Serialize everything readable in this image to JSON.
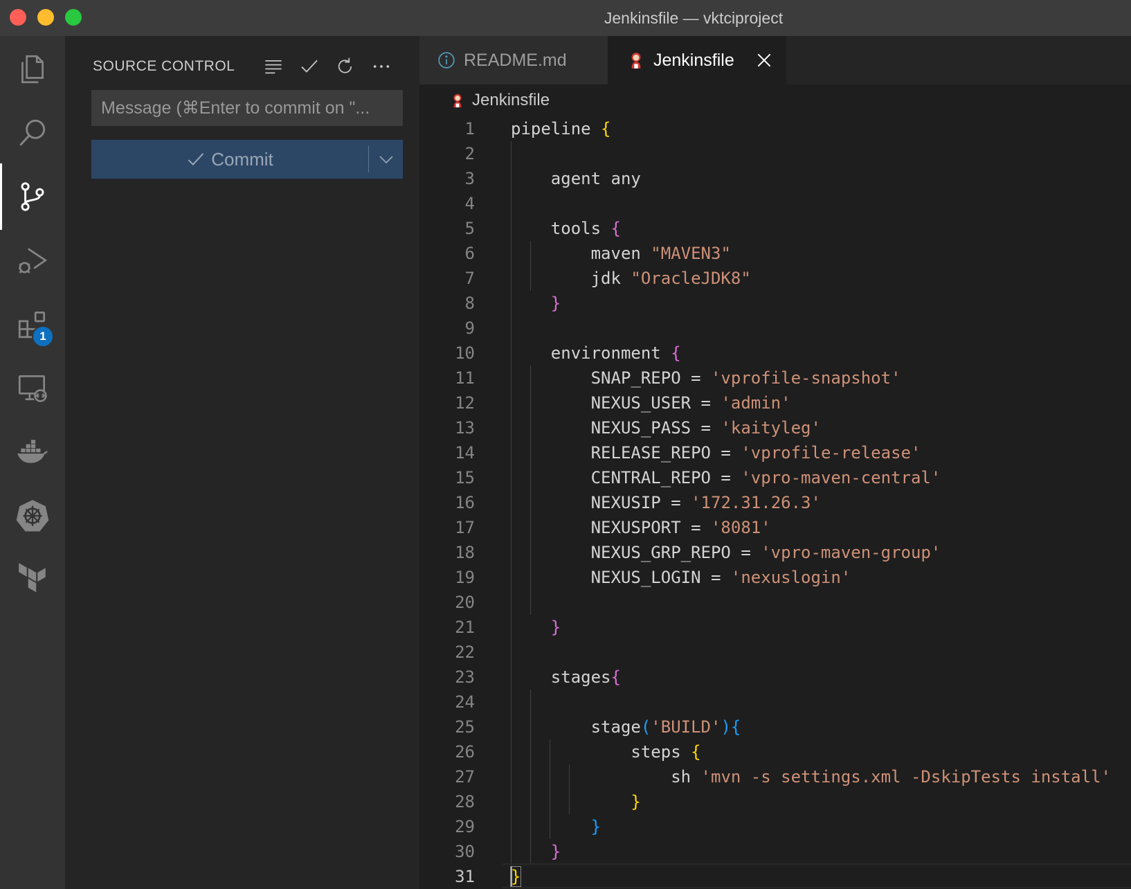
{
  "window": {
    "title": "Jenkinsfile — vktciproject"
  },
  "activity_bar": {
    "items": [
      {
        "name": "explorer-icon"
      },
      {
        "name": "search-icon"
      },
      {
        "name": "source-control-icon",
        "active": true
      },
      {
        "name": "run-debug-icon"
      },
      {
        "name": "extensions-icon",
        "badge": "1"
      },
      {
        "name": "remote-explorer-icon"
      },
      {
        "name": "docker-icon"
      },
      {
        "name": "kubernetes-icon"
      },
      {
        "name": "terraform-icon"
      }
    ]
  },
  "sidebar": {
    "title": "SOURCE CONTROL",
    "message_placeholder": "Message (⌘Enter to commit on \"...",
    "commit_label": "Commit"
  },
  "tabs": [
    {
      "label": "README.md",
      "active": false
    },
    {
      "label": "Jenkinsfile",
      "active": true
    }
  ],
  "breadcrumb": "Jenkinsfile",
  "editor": {
    "current_line": 31,
    "lines": [
      [
        [
          "t",
          "pipeline "
        ],
        [
          "b1",
          "{"
        ]
      ],
      [],
      [
        [
          "t",
          "    agent any"
        ]
      ],
      [],
      [
        [
          "t",
          "    tools "
        ],
        [
          "b2",
          "{"
        ]
      ],
      [
        [
          "t",
          "        maven "
        ],
        [
          "s",
          "\"MAVEN3\""
        ]
      ],
      [
        [
          "t",
          "        jdk "
        ],
        [
          "s",
          "\"OracleJDK8\""
        ]
      ],
      [
        [
          "t",
          "    "
        ],
        [
          "b2",
          "}"
        ]
      ],
      [],
      [
        [
          "t",
          "    environment "
        ],
        [
          "b2",
          "{"
        ]
      ],
      [
        [
          "t",
          "        SNAP_REPO = "
        ],
        [
          "s",
          "'vprofile-snapshot'"
        ]
      ],
      [
        [
          "t",
          "        NEXUS_USER = "
        ],
        [
          "s",
          "'admin'"
        ]
      ],
      [
        [
          "t",
          "        NEXUS_PASS = "
        ],
        [
          "s",
          "'kaityleg'"
        ]
      ],
      [
        [
          "t",
          "        RELEASE_REPO = "
        ],
        [
          "s",
          "'vprofile-release'"
        ]
      ],
      [
        [
          "t",
          "        CENTRAL_REPO = "
        ],
        [
          "s",
          "'vpro-maven-central'"
        ]
      ],
      [
        [
          "t",
          "        NEXUSIP = "
        ],
        [
          "s",
          "'172.31.26.3'"
        ]
      ],
      [
        [
          "t",
          "        NEXUSPORT = "
        ],
        [
          "s",
          "'8081'"
        ]
      ],
      [
        [
          "t",
          "        NEXUS_GRP_REPO = "
        ],
        [
          "s",
          "'vpro-maven-group'"
        ]
      ],
      [
        [
          "t",
          "        NEXUS_LOGIN = "
        ],
        [
          "s",
          "'nexuslogin'"
        ]
      ],
      [],
      [
        [
          "t",
          "    "
        ],
        [
          "b2",
          "}"
        ]
      ],
      [],
      [
        [
          "t",
          "    stages"
        ],
        [
          "b2",
          "{"
        ]
      ],
      [],
      [
        [
          "t",
          "        stage"
        ],
        [
          "b3",
          "("
        ],
        [
          "s",
          "'BUILD'"
        ],
        [
          "b3",
          ")"
        ],
        [
          "b3",
          "{"
        ]
      ],
      [
        [
          "t",
          "            steps "
        ],
        [
          "b1",
          "{"
        ]
      ],
      [
        [
          "t",
          "                sh "
        ],
        [
          "s",
          "'mvn -s settings.xml -DskipTests install'"
        ]
      ],
      [
        [
          "t",
          "            "
        ],
        [
          "b1",
          "}"
        ]
      ],
      [
        [
          "t",
          "        "
        ],
        [
          "b3",
          "}"
        ]
      ],
      [
        [
          "t",
          "    "
        ],
        [
          "b2",
          "}"
        ]
      ],
      [
        [
          "bm",
          "}"
        ]
      ]
    ]
  }
}
